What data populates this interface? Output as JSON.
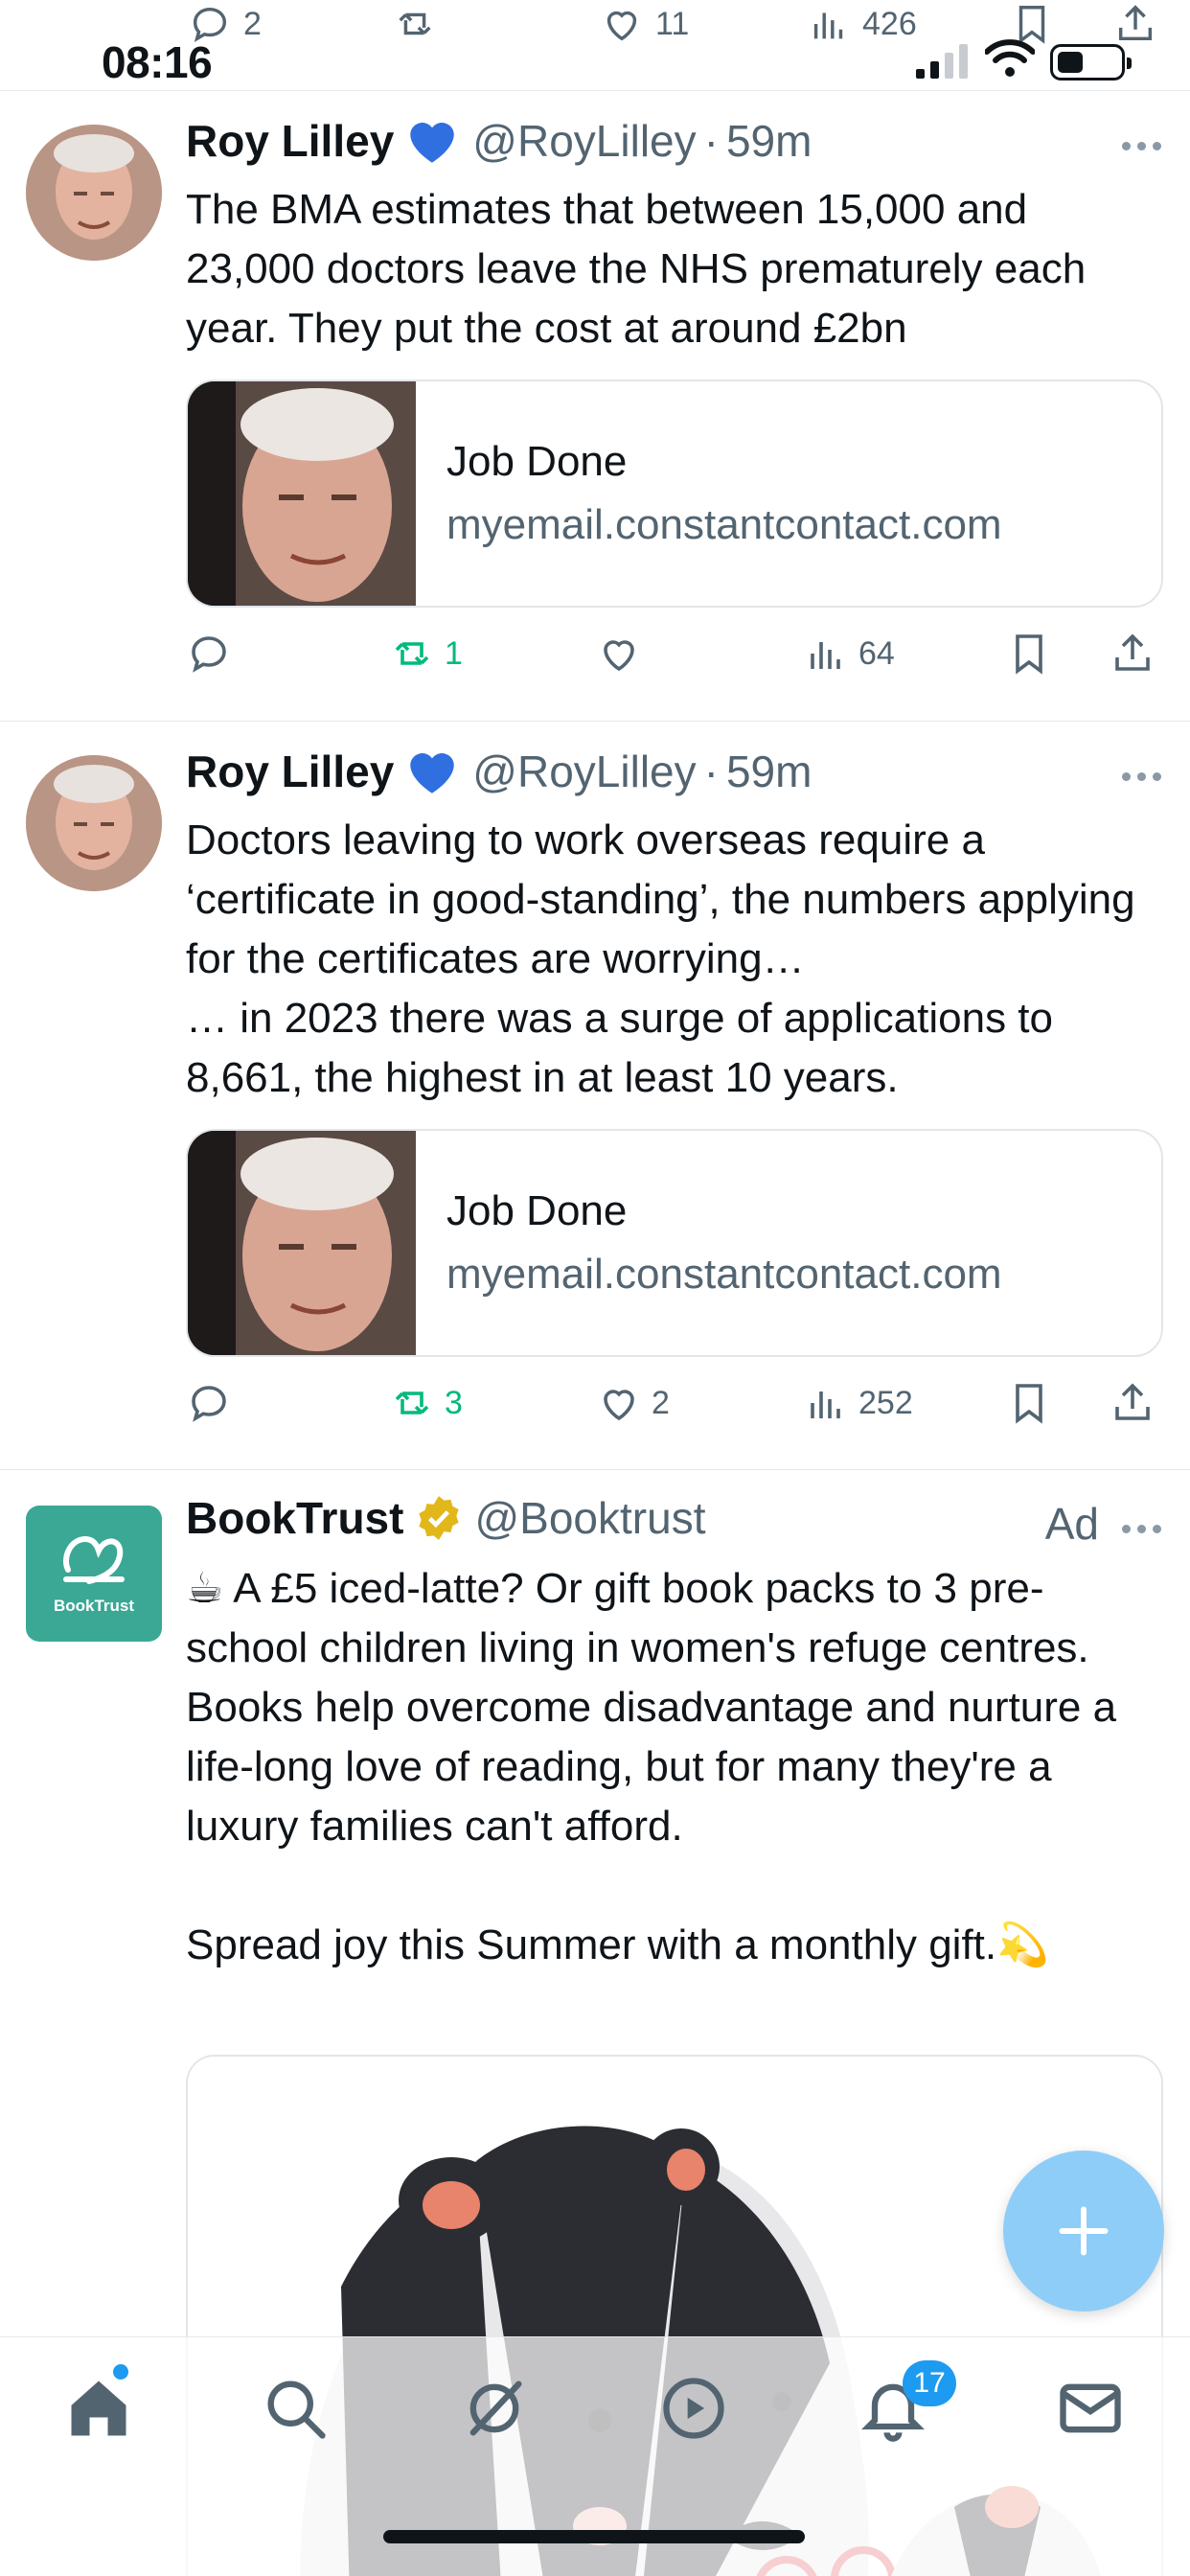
{
  "status_bar": {
    "time": "08:16"
  },
  "previous_tweet_actions": {
    "replies": "2",
    "retweets": "",
    "likes": "11",
    "views": "426"
  },
  "tweets": [
    {
      "name": "Roy Lilley",
      "handle": "@RoyLilley",
      "separator": "·",
      "time": "59m",
      "text": "The BMA estimates that between 15,000 and 23,000 doctors leave the NHS prematurely each year. They put the cost at around £2bn",
      "card": {
        "title": "Job Done",
        "domain": "myemail.constantcontact.com"
      },
      "actions": {
        "replies": "",
        "retweets": "1",
        "likes": "",
        "views": "64"
      }
    },
    {
      "name": "Roy Lilley",
      "handle": "@RoyLilley",
      "separator": "·",
      "time": "59m",
      "text": "Doctors leaving to work overseas require a ‘certificate in good-standing’, the numbers applying for the certificates are worrying…\n… in 2023 there was a surge of applications to 8,661, the highest in at least 10 years.",
      "card": {
        "title": "Job Done",
        "domain": "myemail.constantcontact.com"
      },
      "actions": {
        "replies": "",
        "retweets": "3",
        "likes": "2",
        "views": "252"
      }
    },
    {
      "name": "BookTrust",
      "handle": "@Booktrust",
      "ad_label": "Ad",
      "avatar_text": "BookTrust",
      "text": "☕ A £5 iced-latte? Or gift book packs to 3 pre-school children living in women's refuge centres.\nBooks help overcome disadvantage and nurture a life-long love of reading, but for many they're a luxury families can't afford.\n\nSpread joy this Summer with a monthly gift.💫"
    }
  ],
  "bottom_nav": {
    "notification_count": "17"
  },
  "colors": {
    "accent": "#1d9bf0",
    "retweet_green": "#00ba7c",
    "muted": "#536471",
    "booktrust_teal": "#3aa895"
  }
}
